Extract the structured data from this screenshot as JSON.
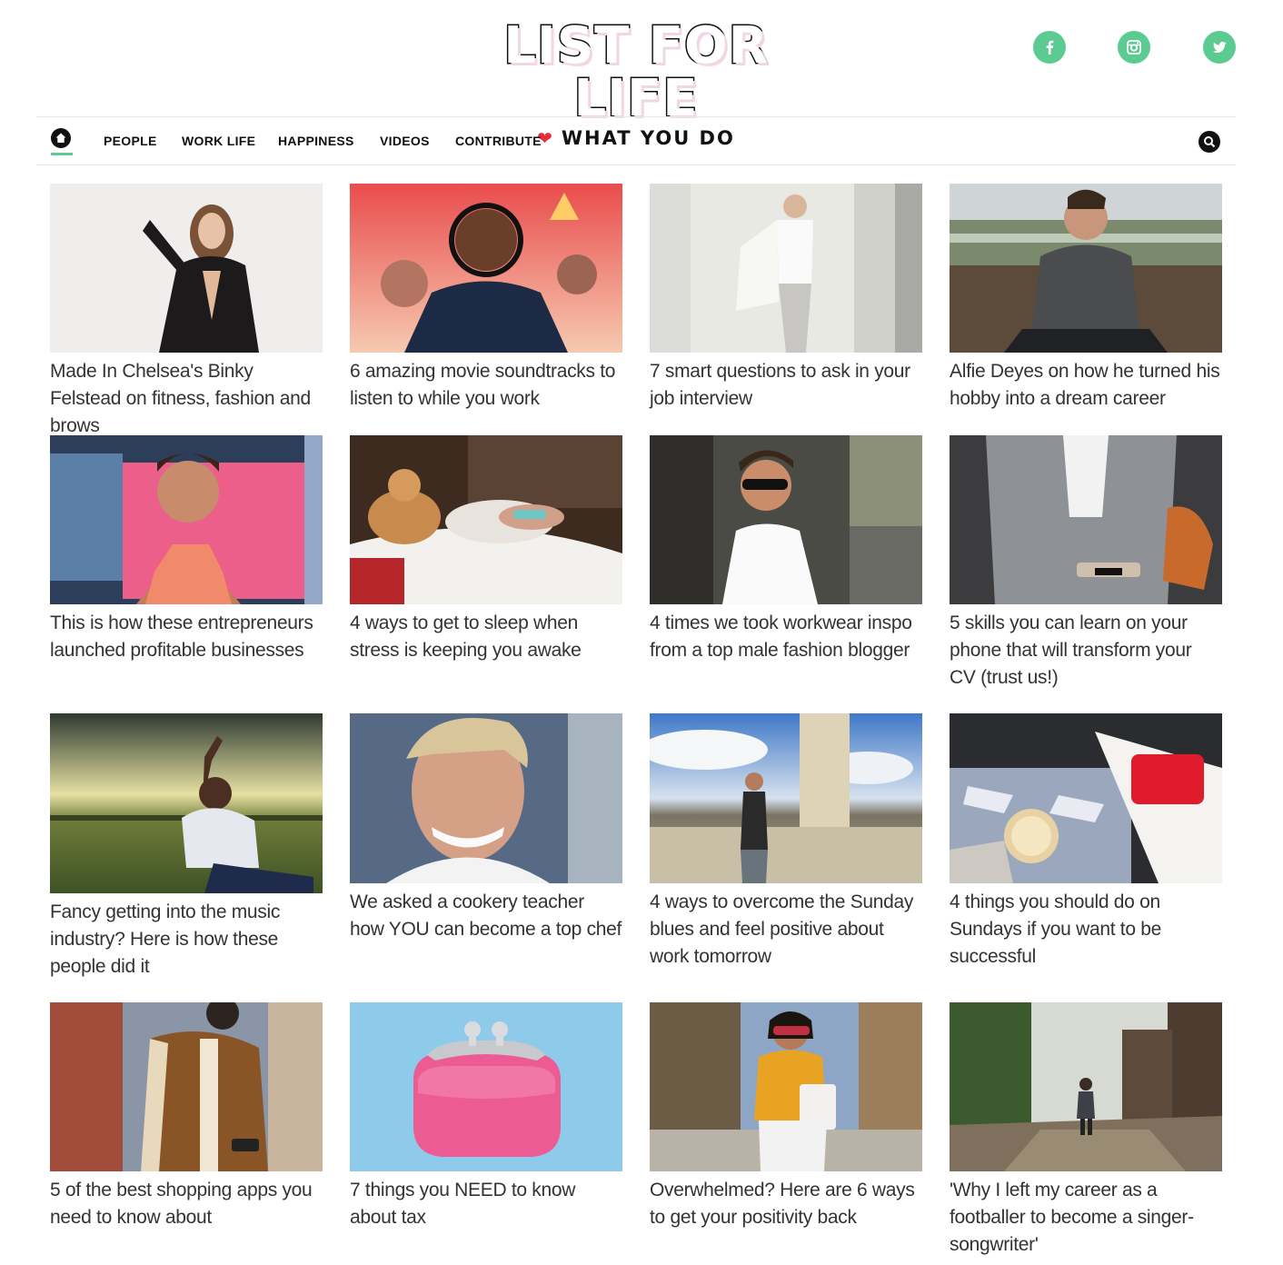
{
  "header": {
    "logo_title": "LIST FOR LIFE",
    "logo_tagline": "WHAT YOU DO",
    "social": [
      {
        "name": "facebook-icon"
      },
      {
        "name": "instagram-icon"
      },
      {
        "name": "twitter-icon"
      }
    ]
  },
  "nav": {
    "items": [
      {
        "label": "PEOPLE"
      },
      {
        "label": "WORK LIFE"
      },
      {
        "label": "HAPPINESS"
      },
      {
        "label": "VIDEOS"
      },
      {
        "label": "CONTRIBUTE"
      }
    ]
  },
  "colors": {
    "accent": "#5ccb92",
    "heart": "#e32d3c"
  },
  "articles": [
    {
      "title": "Made In Chelsea's Binky Felstead on fitness, fashion and brows"
    },
    {
      "title": "6 amazing movie soundtracks to listen to while you work"
    },
    {
      "title": "7 smart questions to ask in your job interview"
    },
    {
      "title": "Alfie Deyes on how he turned his hobby into a dream career"
    },
    {
      "title": "This is how these entrepreneurs launched profitable businesses"
    },
    {
      "title": "4 ways to get to sleep when stress is keeping you awake"
    },
    {
      "title": "4 times we took workwear inspo from a top male fashion blogger"
    },
    {
      "title": "5 skills you can learn on your phone that will transform your CV (trust us!)"
    },
    {
      "title": "Fancy getting into the music industry? Here is how these people did it"
    },
    {
      "title": "We asked a cookery teacher how YOU can become a top chef"
    },
    {
      "title": "4 ways to overcome the Sunday blues and feel positive about work tomorrow"
    },
    {
      "title": "4 things you should do on Sundays if you want to be successful"
    },
    {
      "title": "5 of the best shopping apps you need to know about"
    },
    {
      "title": "7 things you NEED to know about tax"
    },
    {
      "title": "Overwhelmed? Here are 6 ways to get your positivity back"
    },
    {
      "title": "'Why I left my career as a footballer to become a singer-songwriter'"
    }
  ]
}
